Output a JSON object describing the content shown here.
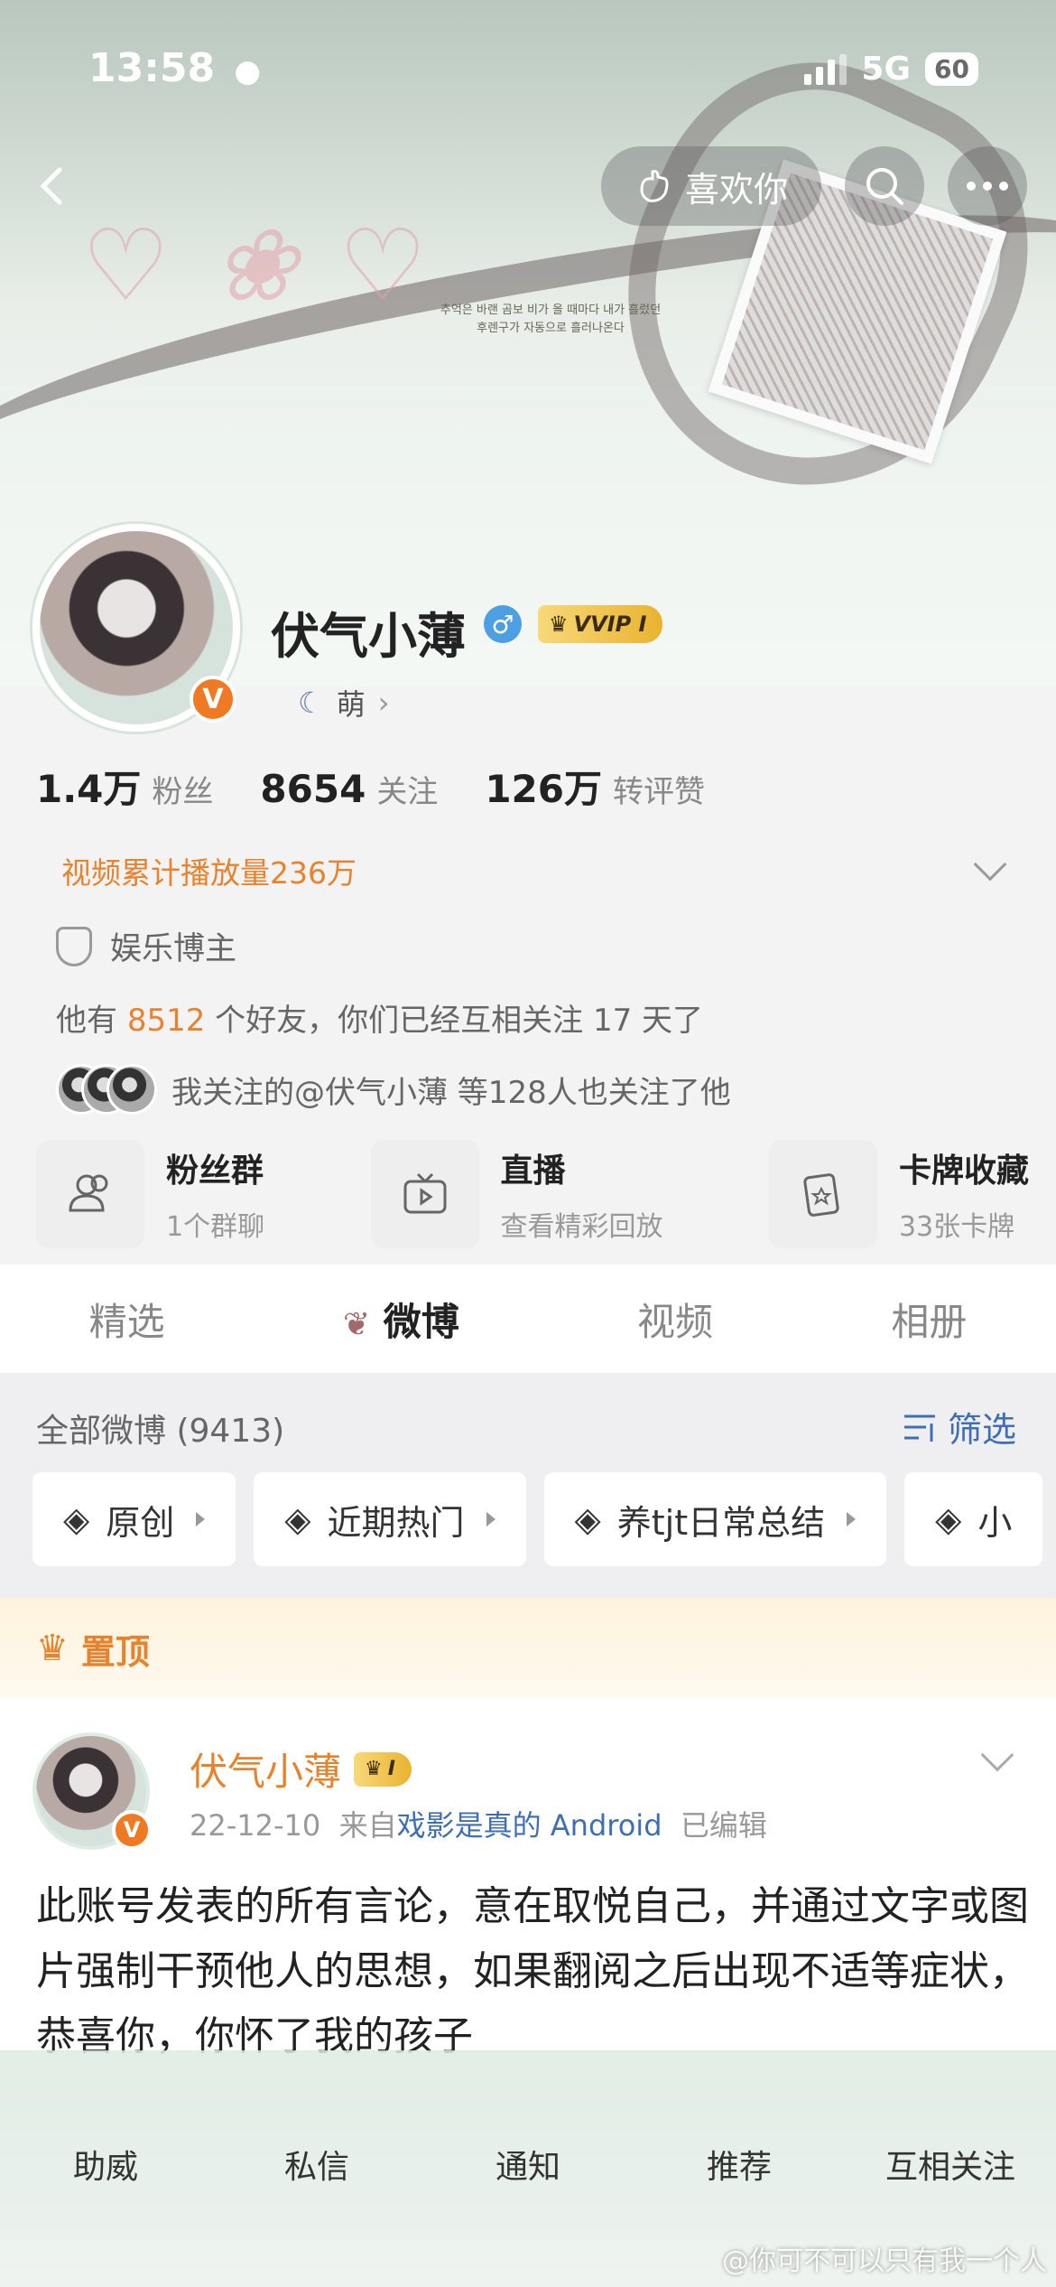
{
  "status_bar": {
    "time": "13:58",
    "network": "5G",
    "battery": "60"
  },
  "header": {
    "like_label": "喜欢你"
  },
  "banner": {
    "korean_line1": "추억은 바랜 곰보 비가 올 때마다 내가 흘렀던",
    "korean_line2": "후렌구가 자동으로 흘러나온다"
  },
  "profile": {
    "name": "伏气小薄",
    "vip_label": "VVIP I",
    "mood": "萌",
    "verified_badge": "V",
    "stats": [
      {
        "num": "1.4万",
        "label": "粉丝"
      },
      {
        "num": "8654",
        "label": "关注"
      },
      {
        "num": "126万",
        "label": "转评赞"
      }
    ],
    "video_views": "视频累计播放量236万",
    "tag": "娱乐博主",
    "friends_pre": "他有",
    "friends_count": "8512",
    "friends_post": "个好友，你们已经互相关注 17 天了",
    "mutual_text": "我关注的@伏气小薄 等128人也关注了他"
  },
  "features": [
    {
      "title": "粉丝群",
      "sub": "1个群聊"
    },
    {
      "title": "直播",
      "sub": "查看精彩回放"
    },
    {
      "title": "卡牌收藏",
      "sub": "33张卡牌"
    }
  ],
  "tabs": [
    "精选",
    "微博",
    "视频",
    "相册"
  ],
  "feed": {
    "all_label": "全部微博 (9413)",
    "filter_label": "筛选",
    "chips": [
      "原创",
      "近期热门",
      "养tjt日常总结",
      "小"
    ],
    "pinned_label": "置顶"
  },
  "post": {
    "author": "伏气小薄",
    "level": "I",
    "date": "22-12-10",
    "from": "来自",
    "source": "戏影是真的 Android",
    "edited": "已编辑",
    "text": "此账号发表的所有言论，意在取悦自己，并通过文字或图片强制干预他人的思想，如果翻阅之后出现不适等症状，恭喜你，你怀了我的孩子"
  },
  "bottom_nav": [
    "助威",
    "私信",
    "通知",
    "推荐",
    "互相关注"
  ],
  "watermark": "@你可不可以只有我一个人",
  "colors": {
    "accent_orange": "#e8822d",
    "link_blue": "#3e6fb4",
    "gold": "#e9b330"
  }
}
